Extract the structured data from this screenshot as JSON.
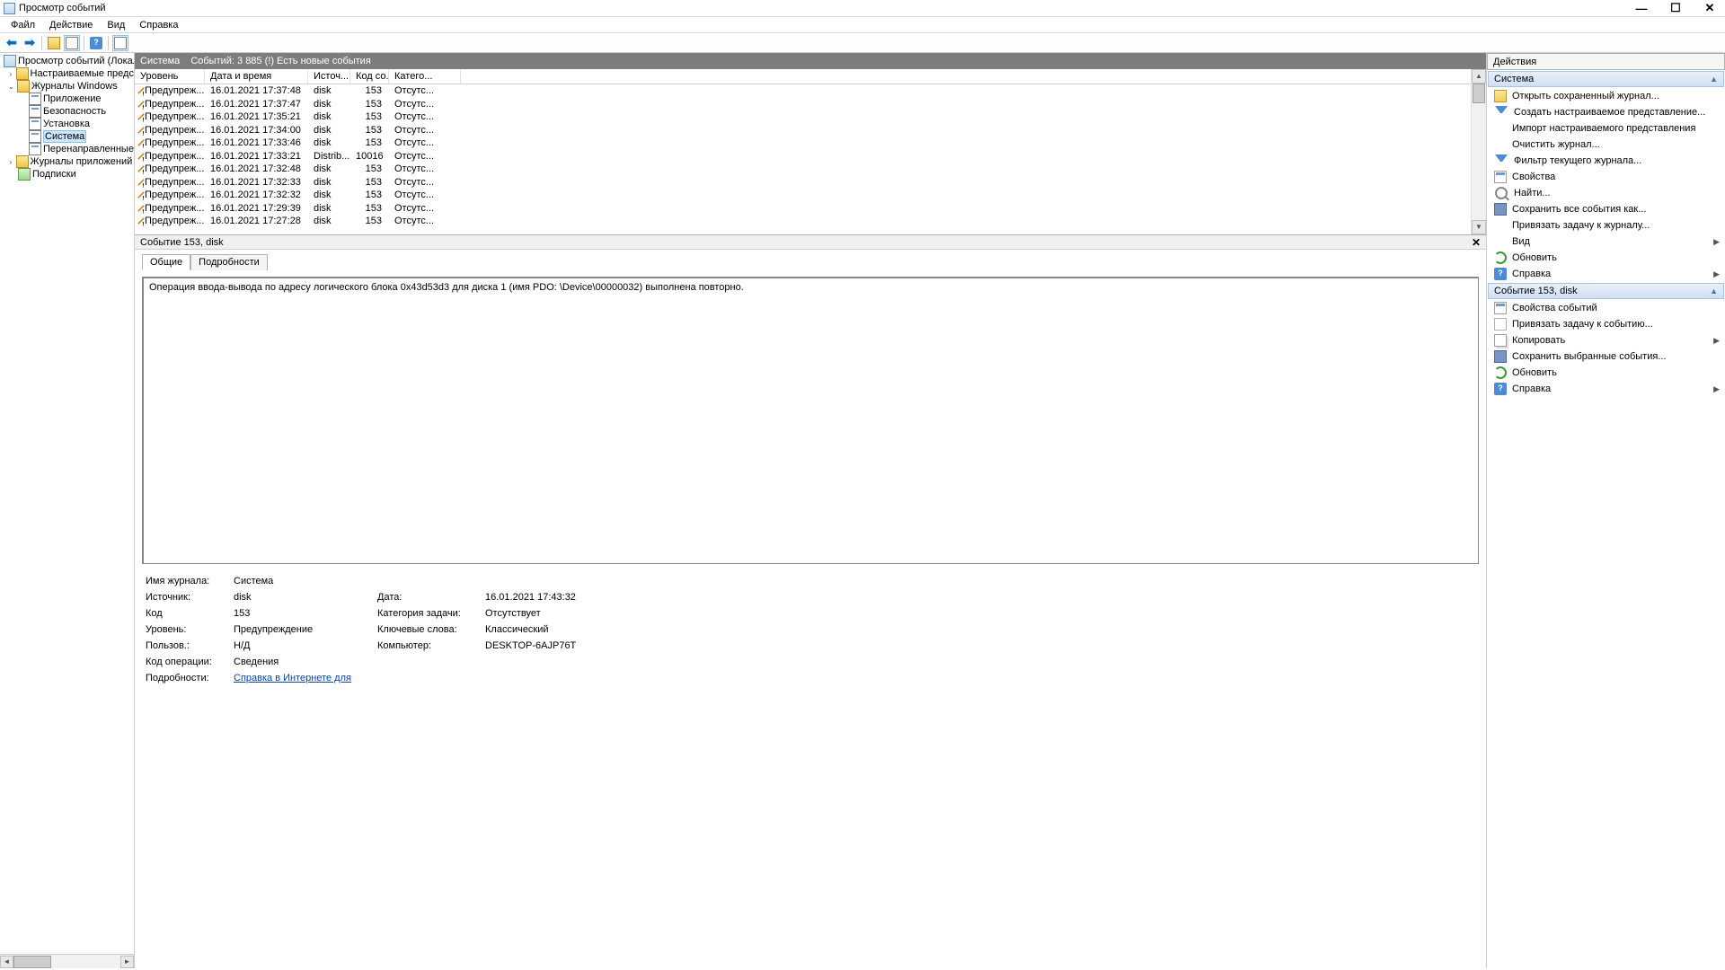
{
  "titlebar": {
    "title": "Просмотр событий"
  },
  "window_controls": {
    "min": "—",
    "max": "☐",
    "close": "✕"
  },
  "menubar": [
    "Файл",
    "Действие",
    "Вид",
    "Справка"
  ],
  "tree": {
    "root": "Просмотр событий (Локальн",
    "customViews": "Настраиваемые представл",
    "winLogs": "Журналы Windows",
    "winItems": [
      "Приложение",
      "Безопасность",
      "Установка",
      "Система",
      "Перенаправленные соб"
    ],
    "appLogs": "Журналы приложений и сл",
    "subs": "Подписки"
  },
  "center": {
    "title": "Система",
    "summary": "Событий: 3 885 (!) Есть новые события",
    "columns": [
      "Уровень",
      "Дата и время",
      "Источ...",
      "Код со...",
      "Катего..."
    ],
    "rows": [
      {
        "lvl": "Предупреж...",
        "dt": "16.01.2021 17:37:48",
        "src": "disk",
        "code": "153",
        "cat": "Отсутс..."
      },
      {
        "lvl": "Предупреж...",
        "dt": "16.01.2021 17:37:47",
        "src": "disk",
        "code": "153",
        "cat": "Отсутс..."
      },
      {
        "lvl": "Предупреж...",
        "dt": "16.01.2021 17:35:21",
        "src": "disk",
        "code": "153",
        "cat": "Отсутс..."
      },
      {
        "lvl": "Предупреж...",
        "dt": "16.01.2021 17:34:00",
        "src": "disk",
        "code": "153",
        "cat": "Отсутс..."
      },
      {
        "lvl": "Предупреж...",
        "dt": "16.01.2021 17:33:46",
        "src": "disk",
        "code": "153",
        "cat": "Отсутс..."
      },
      {
        "lvl": "Предупреж...",
        "dt": "16.01.2021 17:33:21",
        "src": "Distrib...",
        "code": "10016",
        "cat": "Отсутс..."
      },
      {
        "lvl": "Предупреж...",
        "dt": "16.01.2021 17:32:48",
        "src": "disk",
        "code": "153",
        "cat": "Отсутс..."
      },
      {
        "lvl": "Предупреж...",
        "dt": "16.01.2021 17:32:33",
        "src": "disk",
        "code": "153",
        "cat": "Отсутс..."
      },
      {
        "lvl": "Предупреж...",
        "dt": "16.01.2021 17:32:32",
        "src": "disk",
        "code": "153",
        "cat": "Отсутс..."
      },
      {
        "lvl": "Предупреж...",
        "dt": "16.01.2021 17:29:39",
        "src": "disk",
        "code": "153",
        "cat": "Отсутс..."
      },
      {
        "lvl": "Предупреж...",
        "dt": "16.01.2021 17:27:28",
        "src": "disk",
        "code": "153",
        "cat": "Отсутс..."
      }
    ]
  },
  "detail": {
    "header": "Событие 153, disk",
    "tabs": {
      "general": "Общие",
      "details": "Подробности"
    },
    "message": "Операция ввода-вывода по адресу логического блока 0x43d53d3 для диска 1 (имя PDO: \\Device\\00000032) выполнена повторно.",
    "props": {
      "logLbl": "Имя журнала:",
      "logVal": "Система",
      "srcLbl": "Источник:",
      "srcVal": "disk",
      "dateLbl": "Дата:",
      "dateVal": "16.01.2021 17:43:32",
      "codeLbl": "Код",
      "codeVal": "153",
      "taskLbl": "Категория задачи:",
      "taskVal": "Отсутствует",
      "lvlLbl": "Уровень:",
      "lvlVal": "Предупреждение",
      "kwLbl": "Ключевые слова:",
      "kwVal": "Классический",
      "userLbl": "Пользов.:",
      "userVal": "Н/Д",
      "compLbl": "Компьютер:",
      "compVal": "DESKTOP-6AJP76T",
      "opLbl": "Код операции:",
      "opVal": "Сведения",
      "detLbl": "Подробности:",
      "detLink": "Справка в Интернете для "
    }
  },
  "actions": {
    "title": "Действия",
    "sect1": "Система",
    "sect1items": [
      {
        "txt": "Открыть сохраненный журнал...",
        "ic": "ic-open"
      },
      {
        "txt": "Создать настраиваемое представление...",
        "ic": "ic-filter"
      },
      {
        "txt": "Импорт настраиваемого представления",
        "ic": ""
      },
      {
        "txt": "Очистить журнал...",
        "ic": ""
      },
      {
        "txt": "Фильтр текущего журнала...",
        "ic": "ic-filter"
      },
      {
        "txt": "Свойства",
        "ic": "ic-props2"
      },
      {
        "txt": "Найти...",
        "ic": "ic-find"
      },
      {
        "txt": "Сохранить все события как...",
        "ic": "ic-save"
      },
      {
        "txt": "Привязать задачу к журналу...",
        "ic": ""
      },
      {
        "txt": "Вид",
        "ic": "",
        "arrow": true
      },
      {
        "txt": "Обновить",
        "ic": "ic-refresh"
      },
      {
        "txt": "Справка",
        "ic": "ic-help2",
        "arrow": true
      }
    ],
    "sect2": "Событие 153, disk",
    "sect2items": [
      {
        "txt": "Свойства событий",
        "ic": "ic-props2"
      },
      {
        "txt": "Привязать задачу к событию...",
        "ic": "ic-blank"
      },
      {
        "txt": "Копировать",
        "ic": "ic-copy",
        "arrow": true
      },
      {
        "txt": "Сохранить выбранные события...",
        "ic": "ic-save"
      },
      {
        "txt": "Обновить",
        "ic": "ic-refresh"
      },
      {
        "txt": "Справка",
        "ic": "ic-help2",
        "arrow": true
      }
    ]
  }
}
